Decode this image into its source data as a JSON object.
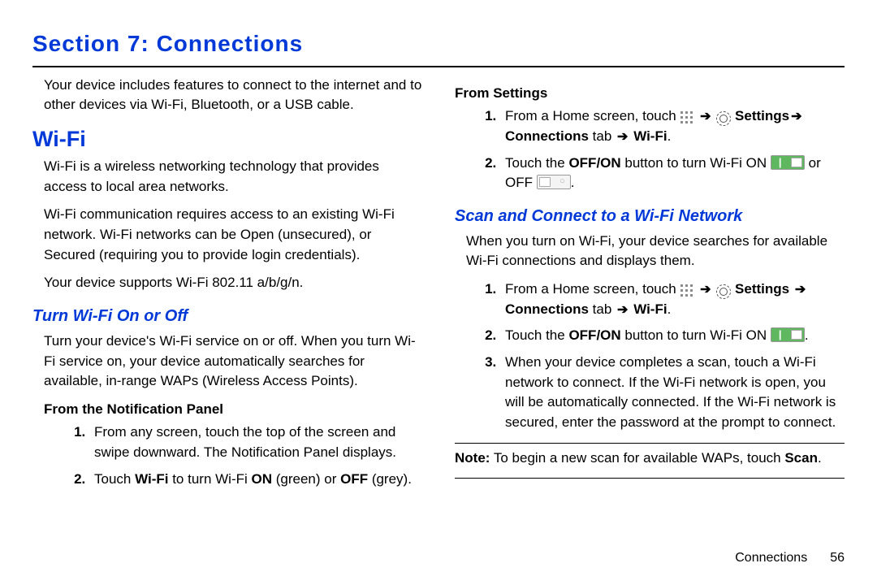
{
  "section": {
    "title": "Section 7: Connections"
  },
  "left": {
    "intro": "Your device includes features to connect to the internet and to other devices via Wi-Fi, Bluetooth, or a USB cable.",
    "wifi_heading": "Wi-Fi",
    "wifi_p1": "Wi-Fi is a wireless networking technology that provides access to local area networks.",
    "wifi_p2": "Wi-Fi communication requires access to an existing Wi-Fi network. Wi-Fi networks can be Open (unsecured), or Secured (requiring you to provide login credentials).",
    "wifi_p3": "Your device supports Wi-Fi 802.11 a/b/g/n.",
    "turn_heading": "Turn Wi-Fi On or Off",
    "turn_p": "Turn your device's Wi-Fi service on or off. When you turn Wi-Fi service on, your device automatically searches for available, in-range WAPs (Wireless Access Points).",
    "notif_heading": "From the Notification Panel",
    "notif_step1": "From any screen, touch the top of the screen and swipe downward. The Notification Panel displays.",
    "notif_step2_a": "Touch ",
    "notif_step2_b": "Wi-Fi",
    "notif_step2_c": " to turn Wi-Fi ",
    "notif_step2_on": "ON",
    "notif_step2_d": " (green) or ",
    "notif_step2_off": "OFF",
    "notif_step2_e": " (grey)."
  },
  "right": {
    "settings_heading": "From Settings",
    "s1_a": "From a Home screen, touch ",
    "s1_settings": "Settings",
    "s1_conn": "Connections",
    "s1_tab": " tab ",
    "s1_wifi": "Wi-Fi",
    "s2_a": "Touch the ",
    "s2_offon": "OFF/ON",
    "s2_b": " button to turn Wi-Fi ON ",
    "s2_c": " or OFF ",
    "scan_heading": "Scan and Connect to a Wi-Fi Network",
    "scan_p": "When you turn on Wi-Fi, your device searches for available Wi-Fi connections and displays them.",
    "sc1_a": "From a Home screen, touch ",
    "sc1_settings": "Settings",
    "sc1_conn": "Connections",
    "sc1_tab": " tab ",
    "sc1_wifi": "Wi-Fi",
    "sc2_a": "Touch the ",
    "sc2_offon": "OFF/ON",
    "sc2_b": " button to turn Wi-Fi ON ",
    "sc3": "When your device completes a scan, touch a Wi-Fi network to connect. If the Wi-Fi network is open, you will be automatically connected. If the Wi-Fi network is secured, enter the password at the prompt to connect.",
    "note_label": "Note:",
    "note_body": " To begin a new scan for available WAPs, touch ",
    "note_scan": "Scan"
  },
  "footer": {
    "label": "Connections",
    "page": "56"
  }
}
